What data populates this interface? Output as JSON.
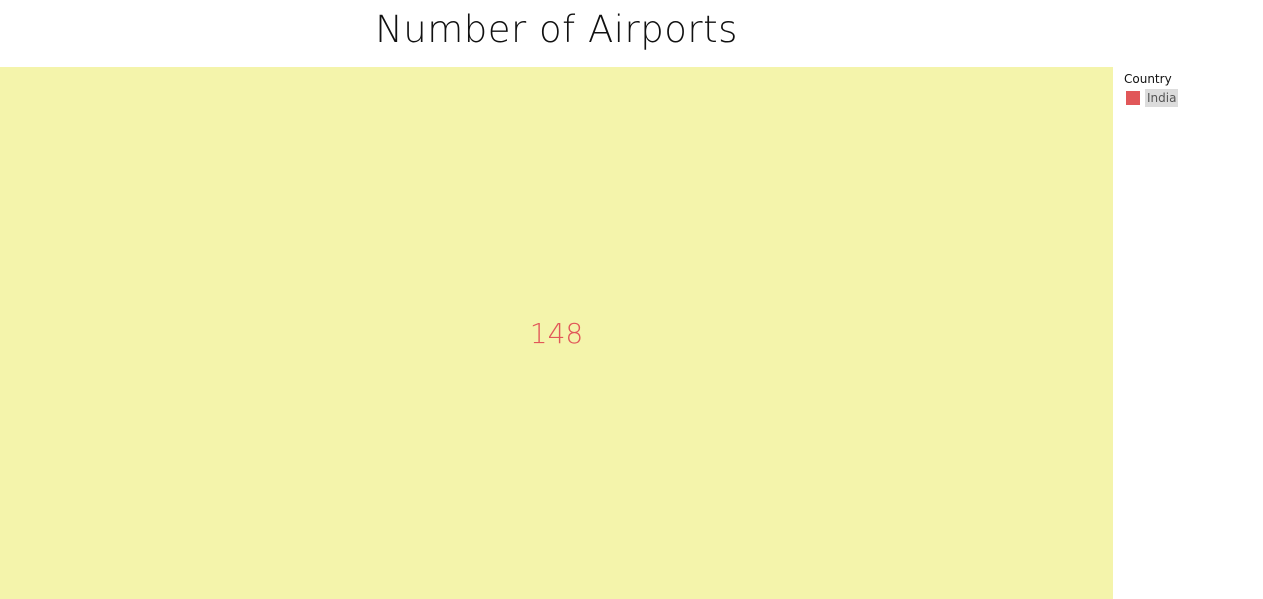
{
  "chart_data": {
    "type": "treemap",
    "title": "Number of Airports",
    "legend": {
      "title": "Country",
      "placement": "right",
      "entries": [
        {
          "label": "India",
          "color": "#e15759"
        }
      ]
    },
    "items": [
      {
        "category": "India",
        "value": 148,
        "label": "148",
        "fill": "#f4f4ab",
        "label_color": "#e15759"
      }
    ]
  }
}
